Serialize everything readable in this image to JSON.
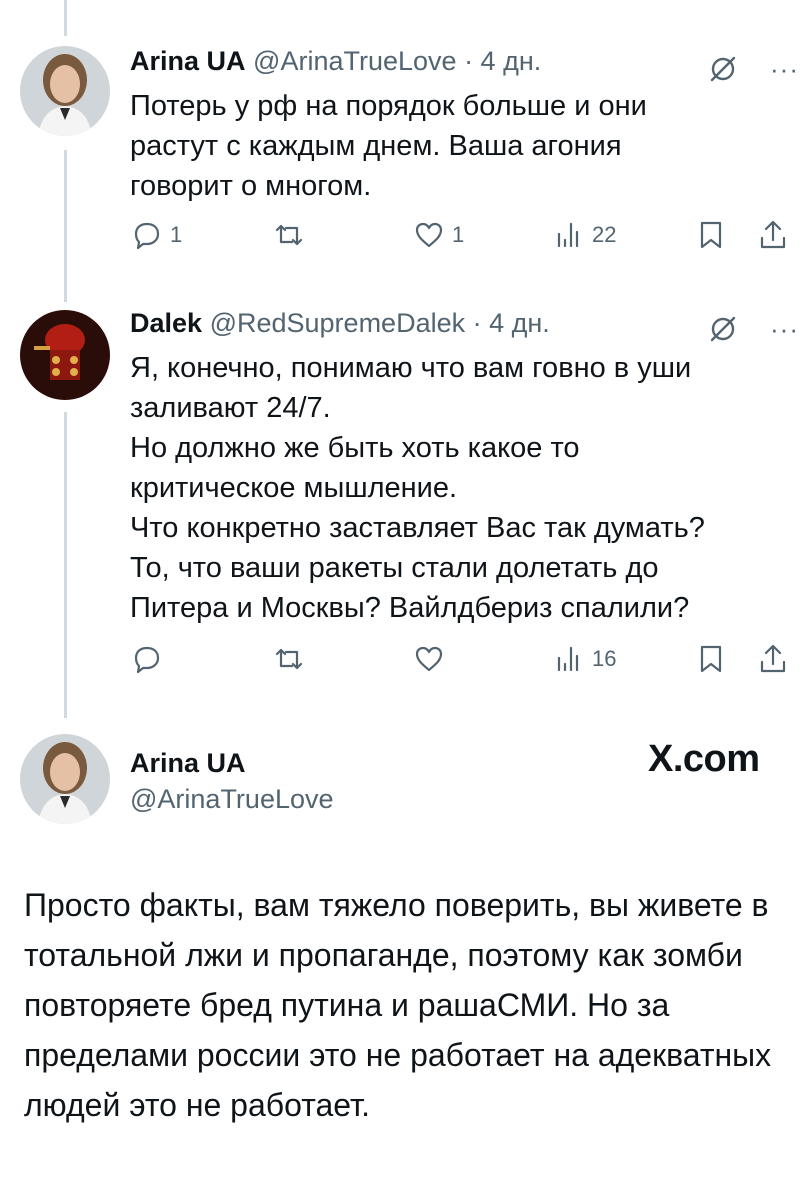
{
  "tweets": [
    {
      "author_name": "Arina UA",
      "handle": "@ArinaTrueLove",
      "time": "· 4 дн.",
      "text": "Потерь у рф на порядок больше и они\nрастут с каждым днем. Ваша агония\nговорит о многом.",
      "replies": "1",
      "reposts": "",
      "likes": "1",
      "views": "22"
    },
    {
      "author_name": "Dalek",
      "handle": "@RedSupremeDalek",
      "time": "· 4 дн.",
      "text": "Я, конечно, понимаю что вам говно в уши\nзаливают 24/7.\nНо должно же быть хоть какое то\nкритическое мышление.\nЧто конкретно заставляет Вас так думать?\nТо, что ваши ракеты стали долетать до\nПитера и Москвы? Вайлдбериз спалили?",
      "replies": "",
      "reposts": "",
      "likes": "",
      "views": "16"
    }
  ],
  "main_tweet": {
    "author_name": "Arina UA",
    "handle": "@ArinaTrueLove",
    "site": "X.com",
    "text": "Просто факты, вам тяжело поверить, вы живете в тотальной лжи и пропаганде, поэтому как зомби повторяете бред путина и рашаСМИ. Но за пределами россии это не работает на адекватных людей это не работает."
  },
  "icons": {
    "reply": "reply-icon",
    "repost": "repost-icon",
    "like": "heart-icon",
    "views": "views-icon",
    "bookmark": "bookmark-icon",
    "share": "share-icon",
    "grok": "grok-icon",
    "more": "more-icon"
  }
}
